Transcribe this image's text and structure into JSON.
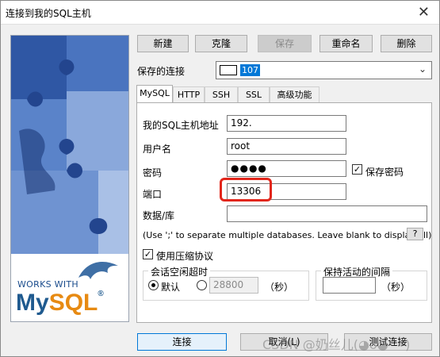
{
  "window": {
    "title": "连接到我的SQL主机",
    "close": "✕"
  },
  "left_image": {
    "works_with": "WORKS WITH",
    "logo_my": "My",
    "logo_sql": "SQL",
    "logo_reg": "®"
  },
  "toolbar": {
    "new": "新建",
    "clone": "克隆",
    "save": "保存",
    "rename": "重命名",
    "delete": "删除"
  },
  "saved_connection": {
    "label": "保存的连接",
    "value": "107"
  },
  "tabs": [
    "MySQL",
    "HTTP",
    "SSH",
    "SSL",
    "高级功能"
  ],
  "form": {
    "host_label": "我的SQL主机地址",
    "host_value": "192.",
    "user_label": "用户名",
    "user_value": "root",
    "password_label": "密码",
    "password_value": "●●●●",
    "save_password_label": "保存密码",
    "save_password_check": "✓",
    "port_label": "端口",
    "port_value": "13306",
    "database_label": "数据/库",
    "database_value": "",
    "hint": "(Use ';' to separate multiple databases. Leave blank to display all)",
    "help": "?",
    "compress_label": "使用压缩协议",
    "compress_check": "✓"
  },
  "session_timeout": {
    "title": "会话空闲超时",
    "default_label": "默认",
    "value": "28800",
    "unit": "（秒）"
  },
  "keepalive": {
    "title": "保持活动的间隔",
    "value": "",
    "unit": "（秒）"
  },
  "footer": {
    "connect": "连接",
    "cancel": "取消(L)",
    "test": "测试连接"
  },
  "watermark": "CSDN @奶丝儿(◕ᴗ◕^*)"
}
